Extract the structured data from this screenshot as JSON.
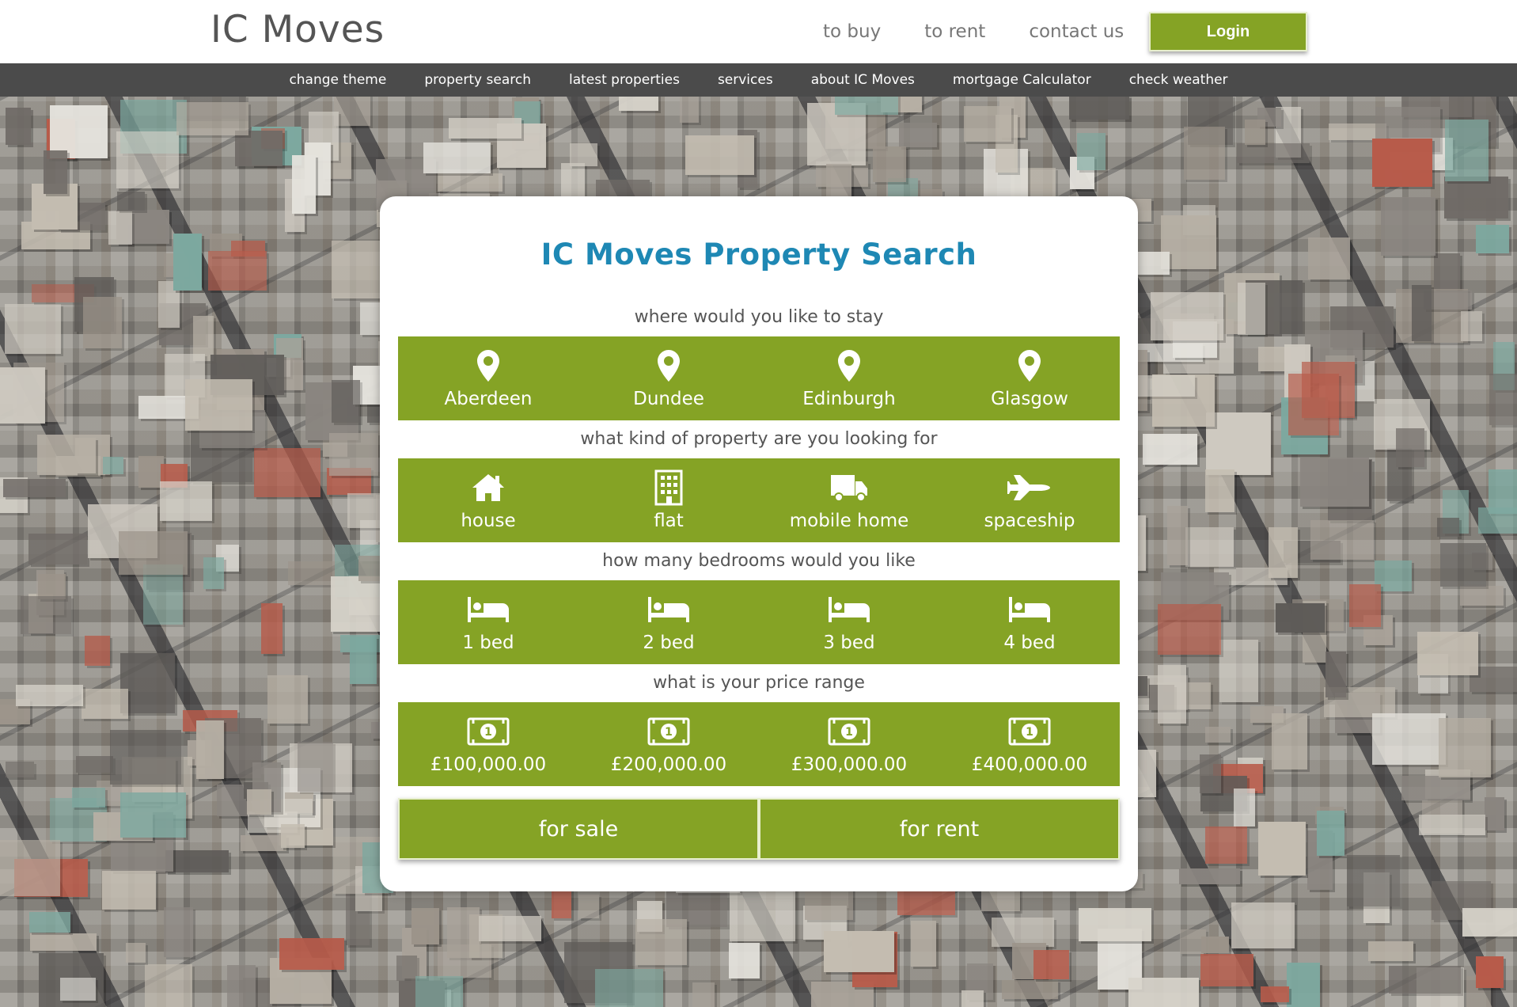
{
  "header": {
    "logo": "IC Moves",
    "nav": [
      "to buy",
      "to rent",
      "contact us"
    ],
    "login_label": "Login"
  },
  "menu": [
    "change theme",
    "property search",
    "latest properties",
    "services",
    "about IC Moves",
    "mortgage Calculator",
    "check weather"
  ],
  "search": {
    "title": "IC Moves Property Search",
    "location_question": "where would you like to stay",
    "locations": [
      {
        "label": "Aberdeen",
        "icon": "map-pin-icon"
      },
      {
        "label": "Dundee",
        "icon": "map-pin-icon"
      },
      {
        "label": "Edinburgh",
        "icon": "map-pin-icon"
      },
      {
        "label": "Glasgow",
        "icon": "map-pin-icon"
      }
    ],
    "type_question": "what kind of property are you looking for",
    "types": [
      {
        "label": "house",
        "icon": "house-icon"
      },
      {
        "label": "flat",
        "icon": "building-icon"
      },
      {
        "label": "mobile home",
        "icon": "truck-icon"
      },
      {
        "label": "spaceship",
        "icon": "space-shuttle-icon"
      }
    ],
    "bedroom_question": "how many bedrooms would you like",
    "bedrooms": [
      {
        "label": "1 bed",
        "icon": "bed-icon"
      },
      {
        "label": "2 bed",
        "icon": "bed-icon"
      },
      {
        "label": "3 bed",
        "icon": "bed-icon"
      },
      {
        "label": "4 bed",
        "icon": "bed-icon"
      }
    ],
    "price_question": "what is your price range",
    "prices": [
      {
        "label": "£100,000.00",
        "icon": "money-icon"
      },
      {
        "label": "£200,000.00",
        "icon": "money-icon"
      },
      {
        "label": "£300,000.00",
        "icon": "money-icon"
      },
      {
        "label": "£400,000.00",
        "icon": "money-icon"
      }
    ],
    "for_sale_label": "for sale",
    "for_rent_label": "for rent"
  },
  "colors": {
    "accent_green": "#85a325",
    "title_blue": "#1e88b4",
    "menubar": "#4b4b4b"
  }
}
